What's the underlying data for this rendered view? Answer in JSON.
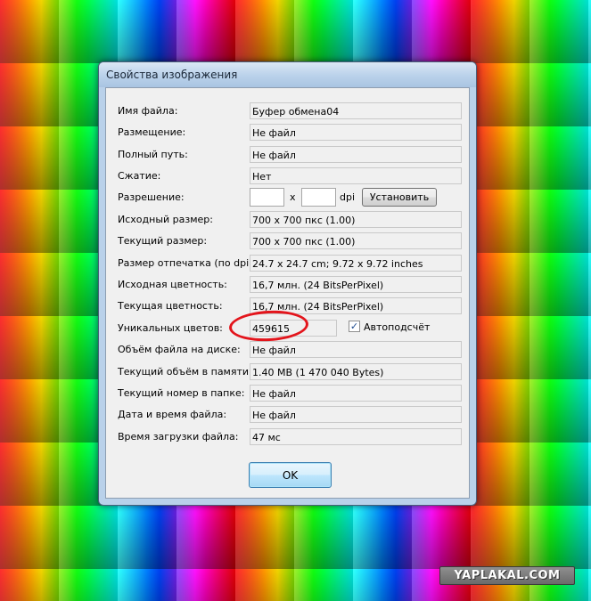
{
  "window": {
    "title": "Свойства изображения"
  },
  "fields": [
    {
      "label": "Имя файла:",
      "value": "Буфер обмена04"
    },
    {
      "label": "Размещение:",
      "value": "Не файл"
    },
    {
      "label": "Полный путь:",
      "value": "Не файл"
    },
    {
      "label": "Сжатие:",
      "value": "Нет"
    },
    {
      "label": "Разрешение:",
      "value": ""
    },
    {
      "label": "Исходный размер:",
      "value": "700 x 700  пкс (1.00)"
    },
    {
      "label": "Текущий размер:",
      "value": "700 x 700  пкс (1.00)"
    },
    {
      "label": "Размер отпечатка (по dpi):",
      "value": "24.7 x 24.7 cm; 9.72 x 9.72 inches"
    },
    {
      "label": "Исходная цветность:",
      "value": "16,7 млн.  (24 BitsPerPixel)"
    },
    {
      "label": "Текущая цветность:",
      "value": "16,7 млн.  (24 BitsPerPixel)"
    },
    {
      "label": "Уникальных цветов:",
      "value": "459615"
    },
    {
      "label": "Объём файла на диске:",
      "value": "Не файл"
    },
    {
      "label": "Текущий объём в памяти:",
      "value": "1.40  MB (1 470 040 Bytes)"
    },
    {
      "label": "Текущий номер в папке:",
      "value": "Не файл"
    },
    {
      "label": "Дата и время файла:",
      "value": "Не файл"
    },
    {
      "label": "Время загрузки файла:",
      "value": "47 мс"
    }
  ],
  "resolution": {
    "x_value": "",
    "y_value": "",
    "separator": "x",
    "unit": "dpi",
    "set_button_label": "Установить"
  },
  "auto_count": {
    "label": "Автоподсчёт",
    "checked": true,
    "check_glyph": "✓"
  },
  "ok_button_label": "OK",
  "watermark": "YAPLAKAL.COM",
  "colors": {
    "highlight_ring": "#e3151c",
    "window_frame": "#b9d1ea"
  }
}
